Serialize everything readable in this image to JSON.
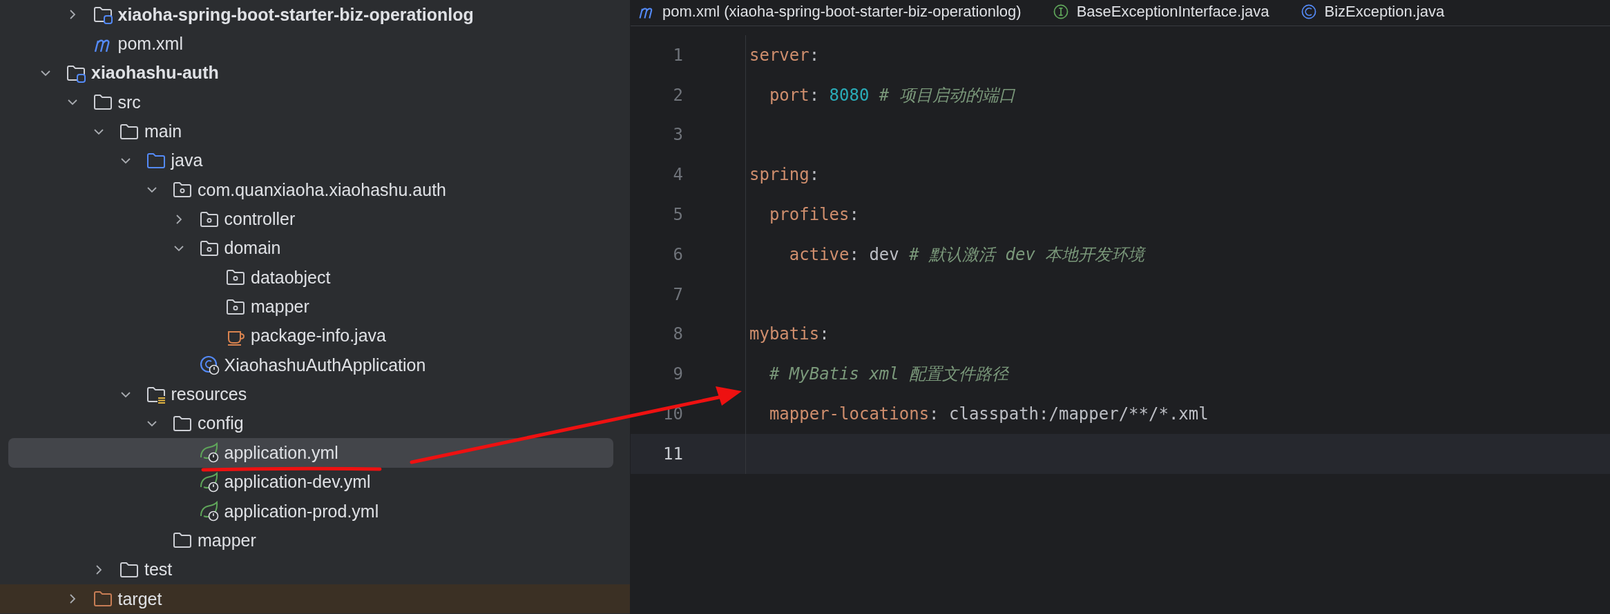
{
  "project_tree": [
    {
      "children": [
        {
          "label": "xiaoha-spring-boot-starter-biz-operationlog",
          "kind": "module",
          "expanded": false,
          "selected": false
        },
        {
          "label": "pom.xml",
          "kind": "pom",
          "selected": false
        }
      ]
    },
    {
      "label": "xiaohashu-auth",
      "kind": "module",
      "expanded": true,
      "selected": false,
      "children": [
        {
          "label": "src",
          "kind": "folder",
          "expanded": true,
          "selected": false,
          "children": [
            {
              "label": "main",
              "kind": "folder",
              "expanded": true,
              "selected": false,
              "children": [
                {
                  "label": "java",
                  "kind": "source-folder",
                  "expanded": true,
                  "selected": false,
                  "children": [
                    {
                      "label": "com.quanxiaoha.xiaohashu.auth",
                      "kind": "package",
                      "expanded": true,
                      "selected": false,
                      "children": [
                        {
                          "label": "controller",
                          "kind": "package",
                          "expanded": false,
                          "selected": false
                        },
                        {
                          "label": "domain",
                          "kind": "package",
                          "expanded": true,
                          "selected": false,
                          "children": [
                            {
                              "label": "dataobject",
                              "kind": "package",
                              "selected": false
                            },
                            {
                              "label": "mapper",
                              "kind": "package",
                              "selected": false
                            },
                            {
                              "label": "package-info.java",
                              "kind": "java-file",
                              "selected": false
                            }
                          ]
                        },
                        {
                          "label": "XiaohashuAuthApplication",
                          "kind": "spring-class",
                          "selected": false
                        }
                      ]
                    }
                  ]
                },
                {
                  "label": "resources",
                  "kind": "resources",
                  "expanded": true,
                  "selected": false,
                  "children": [
                    {
                      "label": "config",
                      "kind": "folder",
                      "expanded": true,
                      "selected": false,
                      "children": [
                        {
                          "label": "application.yml",
                          "kind": "yaml",
                          "selected": true
                        },
                        {
                          "label": "application-dev.yml",
                          "kind": "yaml",
                          "selected": false
                        },
                        {
                          "label": "application-prod.yml",
                          "kind": "yaml",
                          "selected": false
                        }
                      ]
                    },
                    {
                      "label": "mapper",
                      "kind": "folder",
                      "selected": false
                    }
                  ]
                }
              ]
            },
            {
              "label": "test",
              "kind": "folder",
              "expanded": false,
              "selected": false
            }
          ]
        },
        {
          "label": "target",
          "kind": "excluded",
          "expanded": false,
          "selected": false
        }
      ]
    }
  ],
  "editor_tabs": [
    {
      "label": "pom.xml (xiaoha-spring-boot-starter-biz-operationlog)",
      "kind": "maven",
      "selected": false
    },
    {
      "label": "BaseExceptionInterface.java",
      "kind": "interface",
      "selected": false
    },
    {
      "label": "BizException.java",
      "kind": "class",
      "selected": false
    }
  ],
  "code_lines": [
    {
      "number": "1",
      "current": false,
      "tokens": [
        {
          "kind": "key",
          "text": "server"
        },
        {
          "kind": "punct",
          "text": ":"
        }
      ]
    },
    {
      "number": "2",
      "current": false,
      "tokens": [
        {
          "kind": "key",
          "text": "  port"
        },
        {
          "kind": "punct",
          "text": ": "
        },
        {
          "kind": "number",
          "text": "8080"
        },
        {
          "kind": "comment",
          "text": " # 项目启动的端口"
        }
      ]
    },
    {
      "number": "3",
      "current": false
    },
    {
      "number": "4",
      "current": false,
      "tokens": [
        {
          "kind": "key",
          "text": "spring"
        },
        {
          "kind": "punct",
          "text": ":"
        }
      ]
    },
    {
      "number": "5",
      "current": false,
      "tokens": [
        {
          "kind": "key",
          "text": "  profiles"
        },
        {
          "kind": "punct",
          "text": ":"
        }
      ]
    },
    {
      "number": "6",
      "current": false,
      "tokens": [
        {
          "kind": "key",
          "text": "    active"
        },
        {
          "kind": "punct",
          "text": ": "
        },
        {
          "kind": "plain",
          "text": "dev"
        },
        {
          "kind": "comment",
          "text": " # 默认激活 dev 本地开发环境"
        }
      ]
    },
    {
      "number": "7",
      "current": false
    },
    {
      "number": "8",
      "current": false,
      "tokens": [
        {
          "kind": "key",
          "text": "mybatis"
        },
        {
          "kind": "punct",
          "text": ":"
        }
      ]
    },
    {
      "number": "9",
      "current": false,
      "tokens": [
        {
          "kind": "comment",
          "text": "  # MyBatis xml 配置文件路径"
        }
      ]
    },
    {
      "number": "10",
      "current": false,
      "tokens": [
        {
          "kind": "key",
          "text": "  mapper-locations"
        },
        {
          "kind": "punct",
          "text": ": "
        },
        {
          "kind": "plain",
          "text": "classpath:/mapper/**/*.xml"
        }
      ]
    },
    {
      "number": "11",
      "current": true
    }
  ]
}
